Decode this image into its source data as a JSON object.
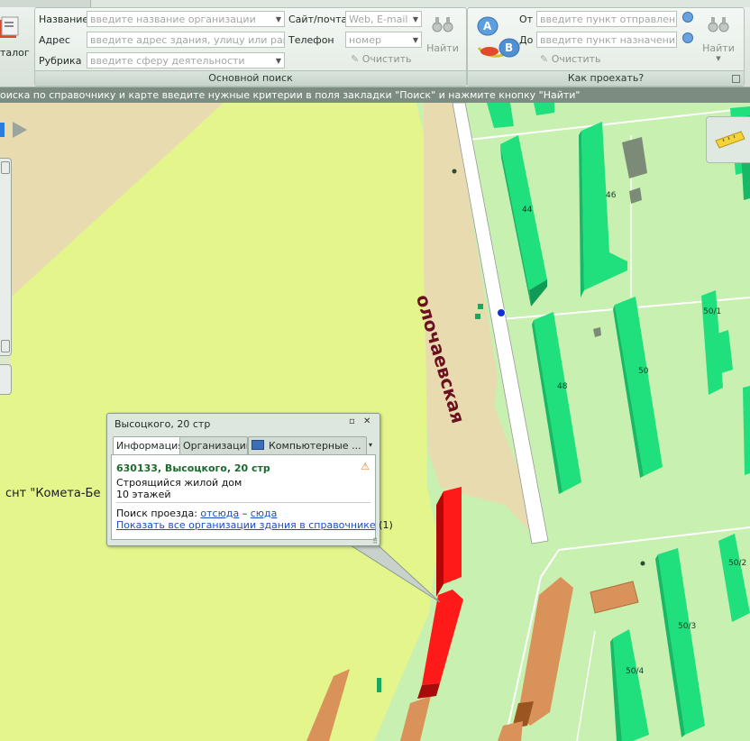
{
  "ribbon": {
    "catalog_label": "талог",
    "main_search": {
      "title": "Основной поиск",
      "name_label": "Название",
      "name_placeholder": "введите название организации",
      "address_label": "Адрес",
      "address_placeholder": "введите адрес здания, улицу или район",
      "rubric_label": "Рубрика",
      "rubric_placeholder": "введите сферу деятельности",
      "site_label": "Сайт/почта",
      "site_placeholder": "Web, E-mail",
      "phone_label": "Телефон",
      "phone_placeholder": "номер",
      "find_label": "Найти",
      "clear_label": "Очистить"
    },
    "route": {
      "title": "Как проехать?",
      "from_label": "От",
      "from_placeholder": "введите пункт отправления",
      "to_label": "До",
      "to_placeholder": "введите пункт назначения",
      "find_label": "Найти",
      "clear_label": "Очистить",
      "badge_a": "A",
      "badge_b": "B"
    }
  },
  "status_text": "оиска по справочнику и карте введите нужные критерии в поля закладки \"Поиск\" и нажмите кнопку \"Найти\"",
  "map": {
    "street_name": "олочаевская",
    "area_label": "снт \"Комета-Бе",
    "building_numbers": [
      "44",
      "46",
      "48",
      "50",
      "50/1",
      "50/2",
      "50/3",
      "50/4"
    ]
  },
  "popup": {
    "title": "Высоцкого, 20 стр",
    "tabs": [
      "Информация",
      "Организации",
      "Компьютерные ..."
    ],
    "address": "630133, Высоцкого, 20 стр",
    "description": "Строящийся жилой дом",
    "floors": "10 этажей",
    "route_prefix": "Поиск проезда:",
    "route_from": "отсюда",
    "route_dash": "–",
    "route_to": "сюда",
    "show_all_link": "Показать все организации здания в справочнике",
    "show_all_count": "(1)"
  },
  "colors": {
    "ribbon_bg": "#e2ebe3",
    "status_bg": "#7c8c80",
    "map_grass": "#c8f0b0",
    "map_field": "#e4f58c",
    "map_sand": "#e9dbb0",
    "building_green": "#1fc572",
    "building_selected": "#ff1a1a",
    "building_brown": "#d9925a",
    "street_label": "#6b1020"
  }
}
